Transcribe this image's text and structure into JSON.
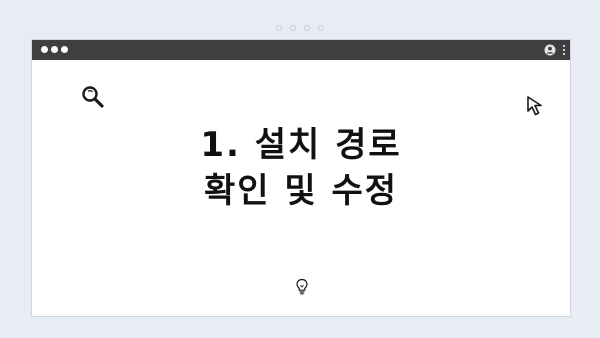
{
  "window": {
    "title_line_1": "1. 설치 경로",
    "title_line_2": "확인 및 수정"
  },
  "icons": {
    "search": "search-icon",
    "cursor": "cursor-arrow-icon",
    "bulb": "lightbulb-icon",
    "profile": "profile-icon",
    "menu": "kebab-menu-icon"
  },
  "colors": {
    "background": "#e8edf3",
    "titlebar": "#3f3f42",
    "window": "#ffffff",
    "text": "#111111"
  }
}
